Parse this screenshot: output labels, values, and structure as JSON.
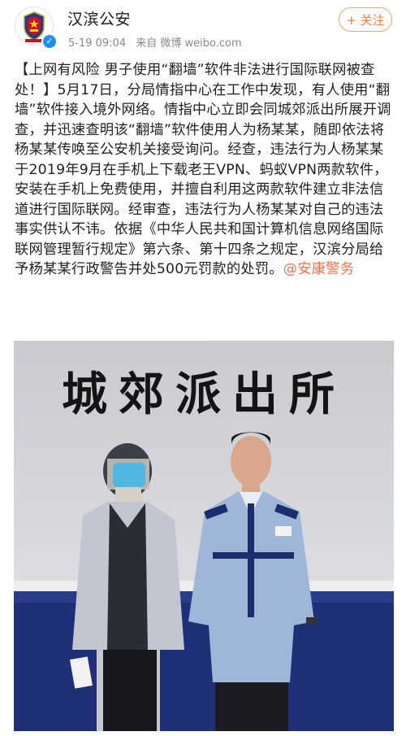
{
  "header": {
    "username": "汉滨公安",
    "time": "5-19 09:04",
    "source": "来自 微博 weibo.com",
    "follow_label": "+ 关注",
    "verified_mark": "✓"
  },
  "post": {
    "text": "【上网有风险 男子使用“翻墙”软件非法进行国际联网被查处！】5月17日，分局情指中心在工作中发现，有人使用“翻墙”软件接入境外网络。情指中心立即会同城郊派出所展开调查，并迅速查明该“翻墙”软件使用人为杨某某，随即依法将杨某某传唤至公安机关接受询问。经查，违法行为人杨某某于2019年9月在手机上下载老王VPN、蚂蚁VPN两款软件，安装在手机上免费使用，并擅自利用这两款软件建立非法信道进行国际联网。经审查，违法行为人杨某某对自己的违法事实供认不讳。依据《中华人民共和国计算机信息网络国际联网管理暂行规定》第六条、第十四条之规定，汉滨分局给予杨某某行政警告并处500元罚款的处罚。",
    "mention": "@安康警务"
  },
  "photo": {
    "sign_text": "城郊派出所"
  },
  "colors": {
    "accent": "#ff7d3d",
    "mention": "#eb7350",
    "verified": "#1e8dff",
    "wall_blue": "#1f2f78"
  }
}
